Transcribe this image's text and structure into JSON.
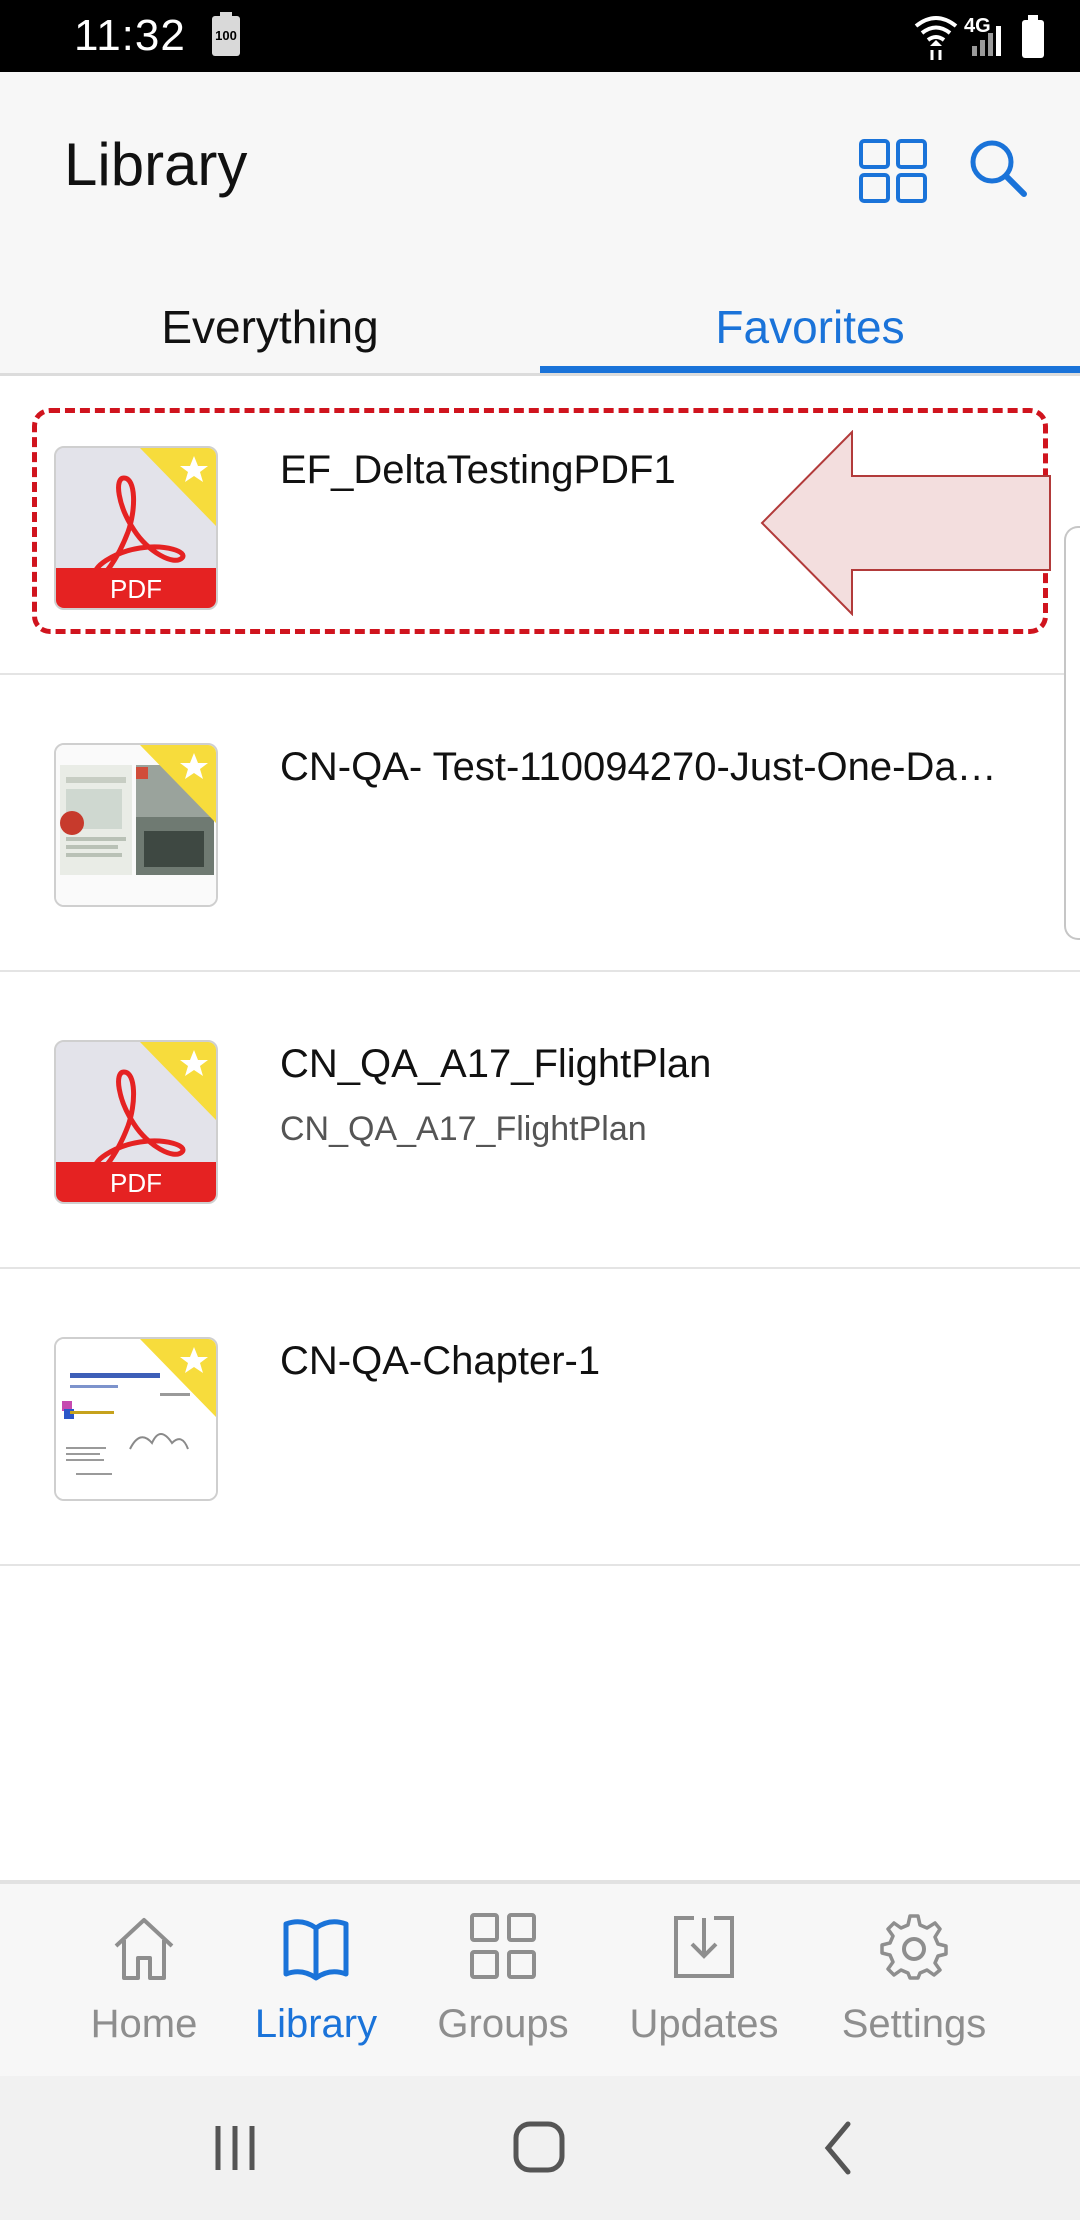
{
  "status_bar": {
    "time": "11:32",
    "battery_saver_label": "100",
    "network_label": "4G"
  },
  "header": {
    "title": "Library",
    "grid_icon": "grid-view-icon",
    "search_icon": "search-icon"
  },
  "tabs": [
    {
      "label": "Everything",
      "active": false
    },
    {
      "label": "Favorites",
      "active": true
    }
  ],
  "items": [
    {
      "title": "EF_DeltaTestingPDF1",
      "subtitle": "",
      "thumb": "pdf",
      "thumb_label": "PDF",
      "favorite": true
    },
    {
      "title": "CN-QA- Test-110094270-Just-One-Da…",
      "subtitle": "",
      "thumb": "magazine",
      "favorite": true
    },
    {
      "title": "CN_QA_A17_FlightPlan",
      "subtitle": "CN_QA_A17_FlightPlan",
      "thumb": "pdf",
      "thumb_label": "PDF",
      "favorite": true
    },
    {
      "title": "CN-QA-Chapter-1",
      "subtitle": "",
      "thumb": "document",
      "favorite": true
    }
  ],
  "bottom_nav": [
    {
      "label": "Home",
      "icon": "home-icon",
      "active": false
    },
    {
      "label": "Library",
      "icon": "book-icon",
      "active": true
    },
    {
      "label": "Groups",
      "icon": "groups-grid-icon",
      "active": false
    },
    {
      "label": "Updates",
      "icon": "download-icon",
      "active": false
    },
    {
      "label": "Settings",
      "icon": "gear-icon",
      "active": false
    }
  ],
  "colors": {
    "accent": "#1a73d9",
    "highlight": "#d0141e",
    "pdf_red": "#e52222",
    "star_yellow": "#f7dc3c"
  }
}
